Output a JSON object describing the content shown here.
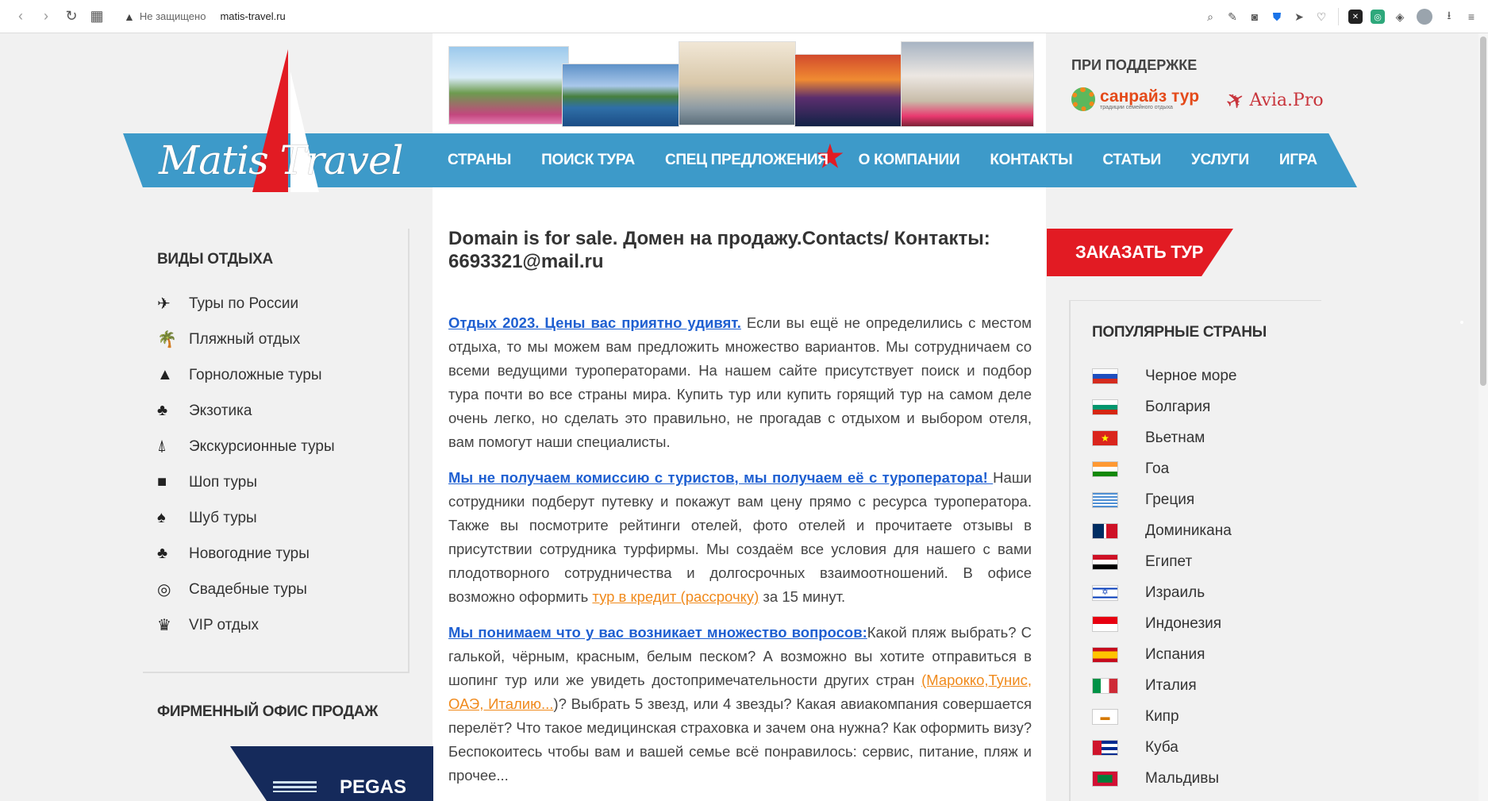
{
  "browser": {
    "security_text": "Не защищено",
    "url": "matis-travel.ru"
  },
  "site": {
    "logo_text": "Matis Travel",
    "menu": [
      "СТРАНЫ",
      "ПОИСК ТУРА",
      "СПЕЦ ПРЕДЛОЖЕНИЯ",
      "О КОМПАНИИ",
      "КОНТАКТЫ",
      "СТАТЬИ",
      "УСЛУГИ",
      "ИГРА"
    ],
    "support_title": "ПРИ ПОДДЕРЖКЕ",
    "sponsor1_name": "санрайз тур",
    "sponsor1_sub": "традиции семейного отдыха",
    "sponsor2_name": "Avia.Pro"
  },
  "left_sidebar": {
    "title": "ВИДЫ ОТДЫХА",
    "items": [
      {
        "label": "Туры по России",
        "icon": "plane-icon"
      },
      {
        "label": "Пляжный отдых",
        "icon": "palm-icon"
      },
      {
        "label": "Горноложные туры",
        "icon": "mountain-icon"
      },
      {
        "label": "Экзотика",
        "icon": "pineapple-icon"
      },
      {
        "label": "Экскурсионные туры",
        "icon": "eiffel-icon"
      },
      {
        "label": "Шоп туры",
        "icon": "shopping-bag-icon"
      },
      {
        "label": "Шуб туры",
        "icon": "fur-coat-icon"
      },
      {
        "label": "Новогодние туры",
        "icon": "christmas-tree-icon"
      },
      {
        "label": "Свадебные туры",
        "icon": "rings-icon"
      },
      {
        "label": "VIP отдых",
        "icon": "crown-icon"
      }
    ],
    "office_title": "ФИРМЕННЫЙ ОФИС ПРОДАЖ",
    "office_brand": "PEGAS"
  },
  "main": {
    "headline": "Domain is for sale. Домен на продажу.Contacts/ Контакты: 6693321@mail.ru",
    "p1_link": "Отдых 2023. Цены вас приятно удивят.",
    "p1_text": " Если вы ещё не определились с местом отдыха, то мы можем вам предложить множество вариантов. Мы сотрудничаем со всеми ведущими туроператорами. На нашем сайте присутствует поиск и подбор тура почти во все страны мира. Купить тур или купить горящий тур на самом деле очень легко, но сделать это правильно, не прогадав с отдыхом и выбором отеля, вам помогут наши специалисты.",
    "p2_link": "Мы не получаем комиссию с туристов, мы получаем её с туроператора! ",
    "p2_text": "Наши сотрудники подберут путевку и покажут вам цену прямо с ресурса туроператора. Также вы посмотрите рейтинги отелей, фото отелей и прочитаете отзывы в присутствии сотрудника турфирмы. Мы создаём все условия для нашего с вами плодотворного сотрудничества и долгосрочных взаимоотношений. В офисе возможно оформить ",
    "p2_orange": "тур в кредит (рассрочку)",
    "p2_end": " за 15 минут.",
    "p3_link": "Мы понимаем что у вас возникает множество вопросов:",
    "p3_text": "Какой пляж выбрать? С галькой, чёрным, красным, белым песком? А возможно вы хотите отправиться в шопинг тур или же увидеть достопримечательности других стран ",
    "p3_orange": "(Марокко,Тунис, ОАЭ, Италию...",
    "p3_end": ")? Выбрать 5 звезд, или 4 звезды? Какая авиакомпания совершается перелёт? Что такое медицинская страховка и зачем она нужна? Как оформить визу? Беспокоитесь чтобы вам и вашей семье всё понравилось: сервис, питание, пляж и прочее..."
  },
  "right_sidebar": {
    "order_button": "ЗАКАЗАТЬ ТУР",
    "title": "ПОПУЛЯРНЫЕ СТРАНЫ",
    "countries": [
      {
        "name": "Черное море",
        "flag": "russia-flag-icon"
      },
      {
        "name": "Болгария",
        "flag": "bulgaria-flag-icon"
      },
      {
        "name": "Вьетнам",
        "flag": "vietnam-flag-icon"
      },
      {
        "name": "Гоа",
        "flag": "india-flag-icon"
      },
      {
        "name": "Греция",
        "flag": "greece-flag-icon"
      },
      {
        "name": "Доминикана",
        "flag": "dominican-flag-icon"
      },
      {
        "name": "Египет",
        "flag": "egypt-flag-icon"
      },
      {
        "name": "Израиль",
        "flag": "israel-flag-icon"
      },
      {
        "name": "Индонезия",
        "flag": "indonesia-flag-icon"
      },
      {
        "name": "Испания",
        "flag": "spain-flag-icon"
      },
      {
        "name": "Италия",
        "flag": "italy-flag-icon"
      },
      {
        "name": "Кипр",
        "flag": "cyprus-flag-icon"
      },
      {
        "name": "Куба",
        "flag": "cuba-flag-icon"
      },
      {
        "name": "Мальдивы",
        "flag": "maldives-flag-icon"
      }
    ]
  },
  "colors": {
    "menu_bar": "#3d9ac9",
    "accent_red": "#e21b23",
    "link_blue": "#1e5fd1",
    "orange": "#f08a1c"
  }
}
